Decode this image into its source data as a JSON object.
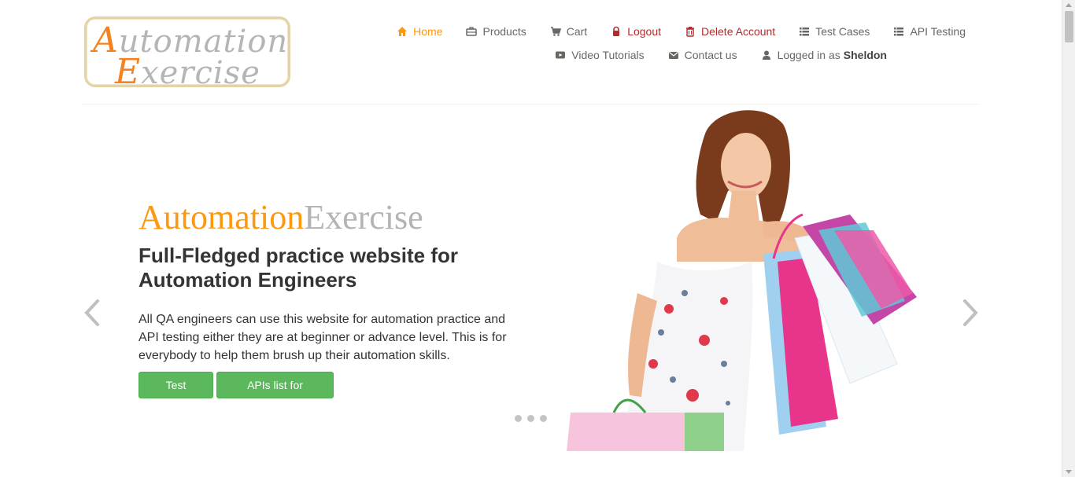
{
  "logo": {
    "line1_cap": "A",
    "line1_rest": "utomation",
    "line2_cap": "E",
    "line2_rest": "xercise"
  },
  "nav": {
    "row1": [
      {
        "label": "Home",
        "icon": "home-icon"
      },
      {
        "label": "Products",
        "icon": "briefcase-icon"
      },
      {
        "label": "Cart",
        "icon": "cart-icon"
      },
      {
        "label": "Logout",
        "icon": "lock-icon"
      },
      {
        "label": "Delete Account",
        "icon": "trash-icon"
      },
      {
        "label": "Test Cases",
        "icon": "list-icon"
      },
      {
        "label": "API Testing",
        "icon": "list-icon"
      }
    ],
    "row2": [
      {
        "label": "Video Tutorials",
        "icon": "youtube-play-icon"
      },
      {
        "label": "Contact us",
        "icon": "envelope-icon"
      },
      {
        "label": "Logged in as",
        "icon": "user-icon",
        "user": "Sheldon"
      }
    ]
  },
  "slider": {
    "brand_part1": "Automation",
    "brand_part2": "Exercise",
    "headline": "Full-Fledged practice website for Automation Engineers",
    "description": "All QA engineers can use this website for automation practice and API testing either they are at beginner or advance level. This is for everybody to help them brush up their automation skills.",
    "button_test_cases": "Test Cases",
    "button_apis": "APIs list for practice",
    "indicator_count": 3
  },
  "colors": {
    "accent": "#fe980f",
    "danger": "#b52a2a",
    "button_green": "#5cb85c",
    "text": "#696763",
    "heading": "#363432"
  }
}
